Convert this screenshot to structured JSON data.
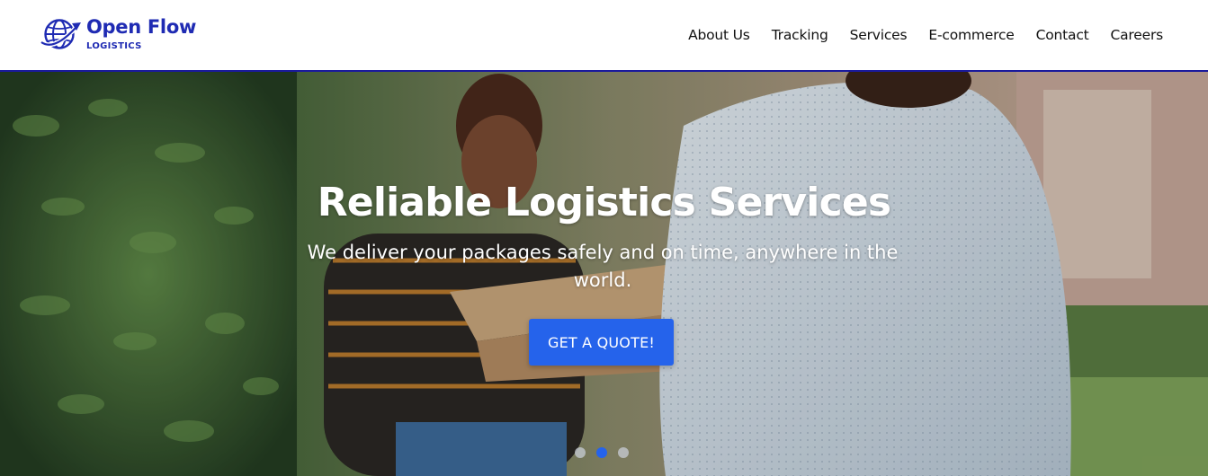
{
  "brand": {
    "name": "Open Flow",
    "tagline": "LOGISTICS",
    "logo_icon": "globe-plane-icon",
    "color": "#1f2bb3"
  },
  "nav": {
    "items": [
      {
        "label": "About Us"
      },
      {
        "label": "Tracking"
      },
      {
        "label": "Services"
      },
      {
        "label": "E-commerce"
      },
      {
        "label": "Contact"
      },
      {
        "label": "Careers"
      }
    ]
  },
  "hero": {
    "title": "Reliable Logistics Services",
    "subtitle": "We deliver your packages safely and on time, anywhere in the world.",
    "cta_label": "GET A QUOTE!",
    "accent": "#2563eb",
    "slides": {
      "count": 3,
      "active": 2
    }
  }
}
